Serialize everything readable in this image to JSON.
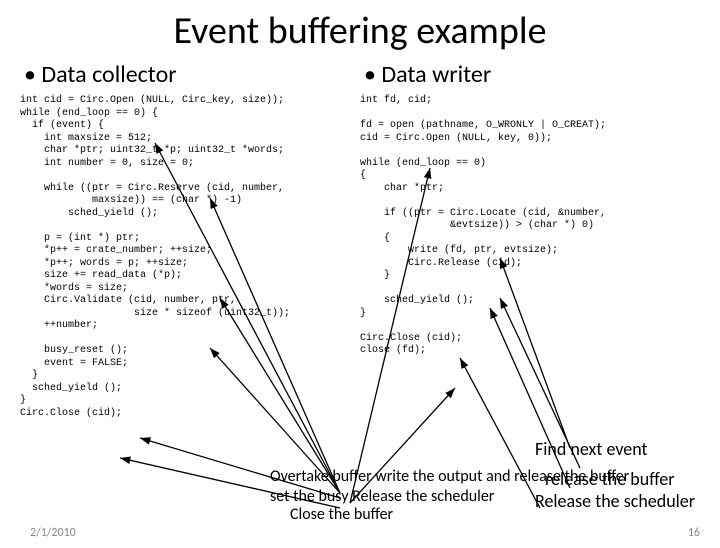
{
  "title": "Event buffering example",
  "left": {
    "heading": "Data collector",
    "code": "int cid = Circ.Open (NULL, Circ_key, size));\nwhile (end_loop == 0) {\n  if (event) {\n    int maxsize = 512;\n    char *ptr; uint32_t *p; uint32_t *words;\n    int number = 0, size = 0;\n\n    while ((ptr = Circ.Reserve (cid, number,\n            maxsize)) == (char *) -1)\n        sched_yield ();\n\n    p = (int *) ptr;\n    *p++ = crate_number; ++size;\n    *p++; words = p; ++size;\n    size += read_data (*p);\n    *words = size;\n    Circ.Validate (cid, number, ptr,\n                   size * sizeof (uint32_t));\n    ++number;\n\n    busy_reset ();\n    event = FALSE;\n  }\n  sched_yield ();\n}\nCirc.Close (cid);"
  },
  "right": {
    "heading": "Data writer",
    "code": "int fd, cid;\n\nfd = open (pathname, O_WRONLY | O_CREAT);\ncid = Circ.Open (NULL, key, 0));\n\nwhile (end_loop == 0)\n{\n    char *ptr;\n\n    if ((ptr = Circ.Locate (cid, &number,\n               &evtsize)) > (char *) 0)\n    {\n        write (fd, ptr, evtsize);\n        Circ.Release (cid);\n    }\n\n    sched_yield ();\n}\n\nCirc.Close (cid);\nclose (fd);"
  },
  "annotations": {
    "find_next": "Find next event",
    "release_buffer": "release the buffer",
    "release_sched": "Release the scheduler"
  },
  "overlap_lines": [
    "Overtake buffer write the output and release the buffer",
    "set the busy Release the scheduler",
    "Close the buffer"
  ],
  "footer": {
    "date": "2/1/2010",
    "page": "16"
  }
}
